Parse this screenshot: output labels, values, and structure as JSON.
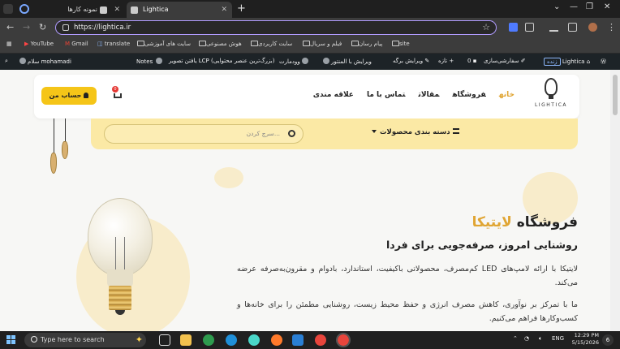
{
  "browser": {
    "tabs": [
      {
        "title": "نمونه کارها",
        "active": false
      },
      {
        "title": "Lightica",
        "active": true
      }
    ],
    "url": "https://lightica.ir",
    "bookmarks": [
      "YouTube",
      "Gmail",
      "translate",
      "سایت های آموزشی",
      "هوش مصنوعی",
      "سایت کاربردی",
      "فیلم و سریال",
      "پیام رسان",
      "site"
    ]
  },
  "adminbar": {
    "site_name": "Lightica",
    "live_badge": "زنده",
    "customize": "سفارشی‌سازی",
    "comments_count": "0",
    "new": "تازه",
    "edit_page": "ویرایش برگه",
    "edit_elementor": "ویرایش با المنتور",
    "woodmart": "وودمارت",
    "lcp": "یافتن تصویر LCP (بزرگ‌ترین عنصر محتوایی)",
    "notes": "Notes",
    "greeting": "سلام mohamadi"
  },
  "site": {
    "logo_text": "LIGHTICA",
    "nav": [
      "خانه",
      "فروشگاه",
      "مقالات",
      "تماس با ما",
      "علاقه مندی"
    ],
    "cart_count": "0",
    "account_button": "حساب من",
    "category_menu": "دسته بندی محصولات",
    "search_placeholder": "سرچ کردن...",
    "hero_title_prefix": "فروشگاه",
    "hero_title_brand": "لایتیکا",
    "hero_subtitle": "روشنایی امروز، صرفه‌جویی برای فردا",
    "hero_p1": "لایتیکا با ارائه لامپ‌های LED کم‌مصرف، محصولاتی باکیفیت، استاندارد، بادوام و مقرون‌به‌صرفه عرضه می‌کند.",
    "hero_p2": "ما با تمرکز بر نوآوری، کاهش مصرف انرژی و حفظ محیط زیست، روشنایی مطمئن را برای خانه‌ها و کسب‌وکارها فراهم می‌کنیم."
  },
  "taskbar": {
    "search_placeholder": "Type here to search",
    "language": "ENG",
    "time": "12:29 PM",
    "date": "5/15/2026",
    "notifications": "6"
  },
  "colors": {
    "accent": "#e0a533",
    "button_yellow": "#f5c518",
    "search_band": "#fbe9a5"
  }
}
